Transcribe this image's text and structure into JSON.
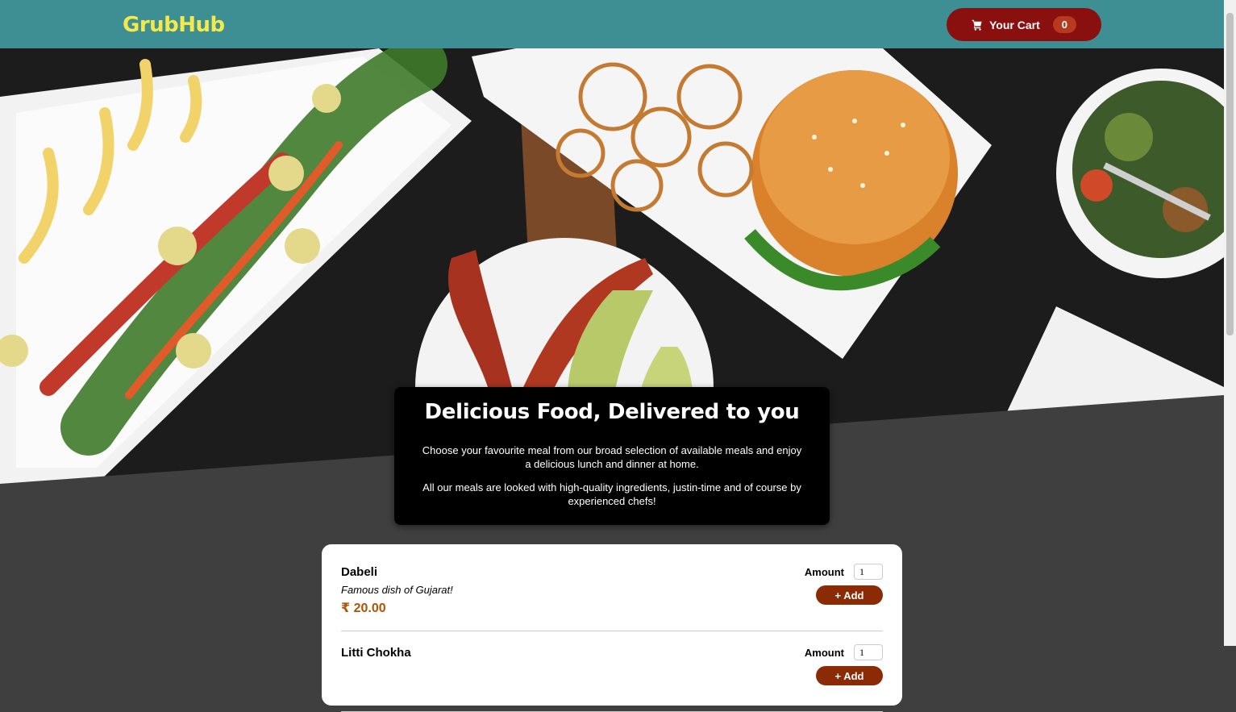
{
  "header": {
    "brand": "GrubHub",
    "cart_label": "Your Cart",
    "cart_count": "0",
    "cart_icon": "cart-icon"
  },
  "summary": {
    "title": "Delicious Food, Delivered to you",
    "paragraph_1": "Choose your favourite meal from our broad selection of available meals and enjoy a delicious lunch and dinner at home.",
    "paragraph_2": "All our meals are looked with high-quality ingredients, justin-time and of course by experienced chefs!"
  },
  "meals": [
    {
      "name": "Dabeli",
      "description": "Famous dish of Gujarat!",
      "price": "₹ 20.00",
      "amount_label": "Amount",
      "amount_value": "1",
      "add_label": "+ Add"
    },
    {
      "name": "Litti Chokha",
      "description": "",
      "price": "",
      "amount_label": "Amount",
      "amount_value": "1",
      "add_label": "+ Add"
    }
  ],
  "colors": {
    "header_bg": "#3d8f94",
    "brand": "#f5e94a",
    "cart_button": "#8a0f0f",
    "price": "#ad5502",
    "add_button": "#8a2b06",
    "page_bg": "#3f3f3f"
  }
}
